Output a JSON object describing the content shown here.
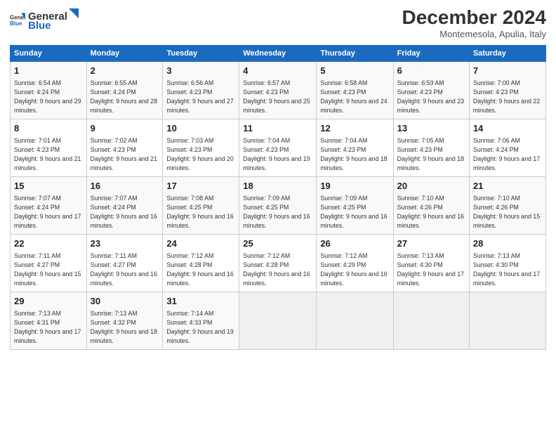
{
  "header": {
    "logo_general": "General",
    "logo_blue": "Blue",
    "month": "December 2024",
    "location": "Montemesola, Apulia, Italy"
  },
  "weekdays": [
    "Sunday",
    "Monday",
    "Tuesday",
    "Wednesday",
    "Thursday",
    "Friday",
    "Saturday"
  ],
  "weeks": [
    [
      {
        "day": "1",
        "sunrise": "6:54 AM",
        "sunset": "4:24 PM",
        "daylight": "9 hours and 29 minutes."
      },
      {
        "day": "2",
        "sunrise": "6:55 AM",
        "sunset": "4:24 PM",
        "daylight": "9 hours and 28 minutes."
      },
      {
        "day": "3",
        "sunrise": "6:56 AM",
        "sunset": "4:23 PM",
        "daylight": "9 hours and 27 minutes."
      },
      {
        "day": "4",
        "sunrise": "6:57 AM",
        "sunset": "4:23 PM",
        "daylight": "9 hours and 25 minutes."
      },
      {
        "day": "5",
        "sunrise": "6:58 AM",
        "sunset": "4:23 PM",
        "daylight": "9 hours and 24 minutes."
      },
      {
        "day": "6",
        "sunrise": "6:59 AM",
        "sunset": "4:23 PM",
        "daylight": "9 hours and 23 minutes."
      },
      {
        "day": "7",
        "sunrise": "7:00 AM",
        "sunset": "4:23 PM",
        "daylight": "9 hours and 22 minutes."
      }
    ],
    [
      {
        "day": "8",
        "sunrise": "7:01 AM",
        "sunset": "4:23 PM",
        "daylight": "9 hours and 21 minutes."
      },
      {
        "day": "9",
        "sunrise": "7:02 AM",
        "sunset": "4:23 PM",
        "daylight": "9 hours and 21 minutes."
      },
      {
        "day": "10",
        "sunrise": "7:03 AM",
        "sunset": "4:23 PM",
        "daylight": "9 hours and 20 minutes."
      },
      {
        "day": "11",
        "sunrise": "7:04 AM",
        "sunset": "4:23 PM",
        "daylight": "9 hours and 19 minutes."
      },
      {
        "day": "12",
        "sunrise": "7:04 AM",
        "sunset": "4:23 PM",
        "daylight": "9 hours and 18 minutes."
      },
      {
        "day": "13",
        "sunrise": "7:05 AM",
        "sunset": "4:23 PM",
        "daylight": "9 hours and 18 minutes."
      },
      {
        "day": "14",
        "sunrise": "7:06 AM",
        "sunset": "4:24 PM",
        "daylight": "9 hours and 17 minutes."
      }
    ],
    [
      {
        "day": "15",
        "sunrise": "7:07 AM",
        "sunset": "4:24 PM",
        "daylight": "9 hours and 17 minutes."
      },
      {
        "day": "16",
        "sunrise": "7:07 AM",
        "sunset": "4:24 PM",
        "daylight": "9 hours and 16 minutes."
      },
      {
        "day": "17",
        "sunrise": "7:08 AM",
        "sunset": "4:25 PM",
        "daylight": "9 hours and 16 minutes."
      },
      {
        "day": "18",
        "sunrise": "7:09 AM",
        "sunset": "4:25 PM",
        "daylight": "9 hours and 16 minutes."
      },
      {
        "day": "19",
        "sunrise": "7:09 AM",
        "sunset": "4:25 PM",
        "daylight": "9 hours and 16 minutes."
      },
      {
        "day": "20",
        "sunrise": "7:10 AM",
        "sunset": "4:26 PM",
        "daylight": "9 hours and 16 minutes."
      },
      {
        "day": "21",
        "sunrise": "7:10 AM",
        "sunset": "4:26 PM",
        "daylight": "9 hours and 15 minutes."
      }
    ],
    [
      {
        "day": "22",
        "sunrise": "7:11 AM",
        "sunset": "4:27 PM",
        "daylight": "9 hours and 15 minutes."
      },
      {
        "day": "23",
        "sunrise": "7:11 AM",
        "sunset": "4:27 PM",
        "daylight": "9 hours and 16 minutes."
      },
      {
        "day": "24",
        "sunrise": "7:12 AM",
        "sunset": "4:28 PM",
        "daylight": "9 hours and 16 minutes."
      },
      {
        "day": "25",
        "sunrise": "7:12 AM",
        "sunset": "4:28 PM",
        "daylight": "9 hours and 16 minutes."
      },
      {
        "day": "26",
        "sunrise": "7:12 AM",
        "sunset": "4:29 PM",
        "daylight": "9 hours and 16 minutes."
      },
      {
        "day": "27",
        "sunrise": "7:13 AM",
        "sunset": "4:30 PM",
        "daylight": "9 hours and 17 minutes."
      },
      {
        "day": "28",
        "sunrise": "7:13 AM",
        "sunset": "4:30 PM",
        "daylight": "9 hours and 17 minutes."
      }
    ],
    [
      {
        "day": "29",
        "sunrise": "7:13 AM",
        "sunset": "4:31 PM",
        "daylight": "9 hours and 17 minutes."
      },
      {
        "day": "30",
        "sunrise": "7:13 AM",
        "sunset": "4:32 PM",
        "daylight": "9 hours and 18 minutes."
      },
      {
        "day": "31",
        "sunrise": "7:14 AM",
        "sunset": "4:33 PM",
        "daylight": "9 hours and 19 minutes."
      },
      null,
      null,
      null,
      null
    ]
  ]
}
